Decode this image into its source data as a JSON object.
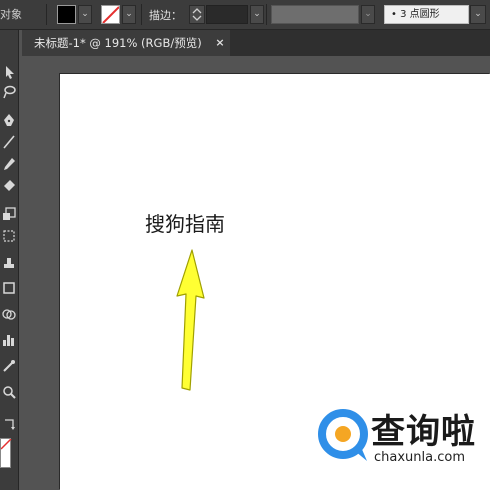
{
  "control_bar": {
    "object_label": "对象",
    "stroke_label": "描边：",
    "stroke_weight": "",
    "profile": "• 3 点圆形",
    "colors": {
      "fill": "#000000",
      "stroke_slash": "#e53030"
    }
  },
  "document_tab": {
    "title": "未标题-1* @ 191% (RGB/预览)",
    "close": "×"
  },
  "artboard": {
    "text": "搜狗指南",
    "arrow_color": "#ffff33"
  },
  "watermark": {
    "brand": "查询啦",
    "url": "chaxunla.com",
    "colors": {
      "ring": "#2f8fe8",
      "accent": "#f5a623"
    }
  },
  "toolbar": {
    "tools": [
      "direct-selection-icon",
      "lasso-icon",
      "pen-icon",
      "line-icon",
      "pencil-icon",
      "eraser-icon",
      "scale-icon",
      "free-transform-icon",
      "symbol-sprayer-icon",
      "rectangle-icon",
      "shape-builder-icon",
      "column-graph-icon",
      "eyedropper-icon",
      "zoom-icon",
      "swap-colors-icon"
    ]
  }
}
